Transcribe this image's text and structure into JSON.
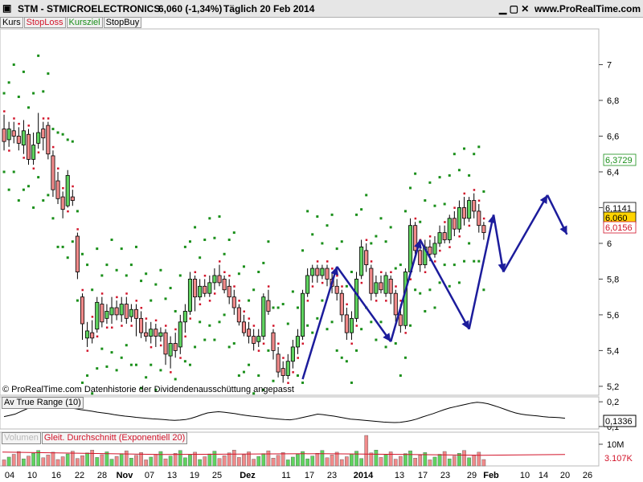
{
  "header": {
    "title": "STM - STMICROELECTRONICS",
    "price_change": "6,060 (-1,34%)",
    "period": "Täglich  20 Feb 2014",
    "site": "www.ProRealTime.com"
  },
  "window_icons": [
    "minimize-icon",
    "maximize-icon",
    "close-icon"
  ],
  "legend": [
    {
      "label": "Kurs",
      "color": "#000000"
    },
    {
      "label": "StopLoss",
      "color": "#d2142a"
    },
    {
      "label": "Kursziel",
      "color": "#1a8f1a"
    },
    {
      "label": "StopBuy",
      "color": "#000000"
    }
  ],
  "watermark": "© ProRealTime.com  Datenhistorie der Dividendenausschüttung angepasst",
  "price_axis": {
    "ticks": [
      "7",
      "6,8",
      "6,6",
      "6,4",
      "6,2",
      "6",
      "5,8",
      "5,6",
      "5,4",
      "5,2"
    ],
    "labels": [
      {
        "text": "6,3729",
        "value": 6.3729,
        "color": "#1a8f1a"
      },
      {
        "text": "6,1141",
        "value": 6.1141,
        "color": "#000000"
      },
      {
        "text": "6,060",
        "value": 6.06,
        "color": "#000000",
        "bg": "#ffd400"
      },
      {
        "text": "6,0156",
        "value": 6.0156,
        "color": "#d2142a"
      }
    ]
  },
  "atr_panel": {
    "label": "Av True Range (10)",
    "ticks": [
      "0,2",
      "0,1"
    ],
    "last_label": "0,1336"
  },
  "volume_panel": {
    "label_volume": "Volumen",
    "label_avg": "Gleit. Durchschnitt (Exponentiell 20)",
    "ticks": [
      "10M"
    ],
    "last_label": "3.107K"
  },
  "date_axis": [
    "04",
    "10",
    "16",
    "22",
    "28",
    "Nov",
    "07",
    "13",
    "19",
    "25",
    "Dez",
    "11",
    "17",
    "23",
    "2014",
    "13",
    "17",
    "23",
    "29",
    "Feb",
    "10",
    "14",
    "20",
    "26"
  ],
  "chart_data": {
    "type": "candlestick",
    "title": "STM - STMICROELECTRONICS",
    "ylim": [
      5.15,
      7.2
    ],
    "candles": [
      {
        "o": 6.64,
        "c": 6.57,
        "h": 6.72,
        "l": 6.52
      },
      {
        "o": 6.58,
        "c": 6.64,
        "h": 6.68,
        "l": 6.54
      },
      {
        "o": 6.63,
        "c": 6.6,
        "h": 6.68,
        "l": 6.56
      },
      {
        "o": 6.6,
        "c": 6.56,
        "h": 6.65,
        "l": 6.52
      },
      {
        "o": 6.55,
        "c": 6.63,
        "h": 6.69,
        "l": 6.5
      },
      {
        "o": 6.61,
        "c": 6.47,
        "h": 6.64,
        "l": 6.44
      },
      {
        "o": 6.47,
        "c": 6.55,
        "h": 6.62,
        "l": 6.44
      },
      {
        "o": 6.56,
        "c": 6.62,
        "h": 6.73,
        "l": 6.53
      },
      {
        "o": 6.64,
        "c": 6.59,
        "h": 6.68,
        "l": 6.52
      },
      {
        "o": 6.66,
        "c": 6.5,
        "h": 6.68,
        "l": 6.47
      },
      {
        "o": 6.49,
        "c": 6.3,
        "h": 6.52,
        "l": 6.26
      },
      {
        "o": 6.35,
        "c": 6.25,
        "h": 6.4,
        "l": 6.22
      },
      {
        "o": 6.26,
        "c": 6.19,
        "h": 6.29,
        "l": 6.14
      },
      {
        "o": 6.21,
        "c": 6.38,
        "h": 6.41,
        "l": 6.2
      },
      {
        "o": 6.26,
        "c": 6.24,
        "h": 6.3,
        "l": 6.21
      },
      {
        "o": 6.04,
        "c": 5.84,
        "h": 6.06,
        "l": 5.8
      },
      {
        "o": 5.7,
        "c": 5.55,
        "h": 5.72,
        "l": 5.46
      },
      {
        "o": 5.47,
        "c": 5.51,
        "h": 5.56,
        "l": 5.42
      },
      {
        "o": 5.5,
        "c": 5.47,
        "h": 5.57,
        "l": 5.44
      },
      {
        "o": 5.52,
        "c": 5.67,
        "h": 5.7,
        "l": 5.5
      },
      {
        "o": 5.66,
        "c": 5.56,
        "h": 5.7,
        "l": 5.53
      },
      {
        "o": 5.58,
        "c": 5.62,
        "h": 5.66,
        "l": 5.55
      },
      {
        "o": 5.6,
        "c": 5.64,
        "h": 5.7,
        "l": 5.55
      },
      {
        "o": 5.64,
        "c": 5.6,
        "h": 5.68,
        "l": 5.57
      },
      {
        "o": 5.6,
        "c": 5.66,
        "h": 5.7,
        "l": 5.56
      },
      {
        "o": 5.66,
        "c": 5.58,
        "h": 5.7,
        "l": 5.55
      },
      {
        "o": 5.59,
        "c": 5.63,
        "h": 5.66,
        "l": 5.56
      },
      {
        "o": 5.63,
        "c": 5.58,
        "h": 5.66,
        "l": 5.48
      },
      {
        "o": 5.58,
        "c": 5.5,
        "h": 5.62,
        "l": 5.47
      },
      {
        "o": 5.5,
        "c": 5.48,
        "h": 5.56,
        "l": 5.45
      },
      {
        "o": 5.48,
        "c": 5.52,
        "h": 5.56,
        "l": 5.44
      },
      {
        "o": 5.52,
        "c": 5.48,
        "h": 5.55,
        "l": 5.42
      },
      {
        "o": 5.48,
        "c": 5.5,
        "h": 5.53,
        "l": 5.45
      },
      {
        "o": 5.5,
        "c": 5.38,
        "h": 5.52,
        "l": 5.32
      },
      {
        "o": 5.37,
        "c": 5.44,
        "h": 5.48,
        "l": 5.3
      },
      {
        "o": 5.44,
        "c": 5.4,
        "h": 5.5,
        "l": 5.36
      },
      {
        "o": 5.42,
        "c": 5.56,
        "h": 5.6,
        "l": 5.38
      },
      {
        "o": 5.56,
        "c": 5.62,
        "h": 5.66,
        "l": 5.5
      },
      {
        "o": 5.62,
        "c": 5.8,
        "h": 5.84,
        "l": 5.6
      },
      {
        "o": 5.8,
        "c": 5.7,
        "h": 5.82,
        "l": 5.62
      },
      {
        "o": 5.7,
        "c": 5.76,
        "h": 5.8,
        "l": 5.68
      },
      {
        "o": 5.76,
        "c": 5.72,
        "h": 5.8,
        "l": 5.7
      },
      {
        "o": 5.72,
        "c": 5.78,
        "h": 5.82,
        "l": 5.7
      },
      {
        "o": 5.78,
        "c": 5.82,
        "h": 5.86,
        "l": 5.74
      },
      {
        "o": 5.82,
        "c": 5.78,
        "h": 5.88,
        "l": 5.76
      },
      {
        "o": 5.8,
        "c": 5.74,
        "h": 5.82,
        "l": 5.72
      },
      {
        "o": 5.76,
        "c": 5.7,
        "h": 5.8,
        "l": 5.66
      },
      {
        "o": 5.7,
        "c": 5.64,
        "h": 5.74,
        "l": 5.6
      },
      {
        "o": 5.64,
        "c": 5.56,
        "h": 5.66,
        "l": 5.54
      },
      {
        "o": 5.56,
        "c": 5.5,
        "h": 5.6,
        "l": 5.48
      },
      {
        "o": 5.52,
        "c": 5.48,
        "h": 5.56,
        "l": 5.44
      },
      {
        "o": 5.48,
        "c": 5.44,
        "h": 5.52,
        "l": 5.4
      },
      {
        "o": 5.45,
        "c": 5.48,
        "h": 5.52,
        "l": 5.42
      },
      {
        "o": 5.48,
        "c": 5.7,
        "h": 5.72,
        "l": 5.46
      },
      {
        "o": 5.68,
        "c": 5.62,
        "h": 5.74,
        "l": 5.6
      },
      {
        "o": 5.5,
        "c": 5.4,
        "h": 5.52,
        "l": 5.35
      },
      {
        "o": 5.38,
        "c": 5.28,
        "h": 5.42,
        "l": 5.25
      },
      {
        "o": 5.3,
        "c": 5.26,
        "h": 5.34,
        "l": 5.22
      },
      {
        "o": 5.26,
        "c": 5.34,
        "h": 5.38,
        "l": 5.24
      },
      {
        "o": 5.34,
        "c": 5.42,
        "h": 5.46,
        "l": 5.3
      },
      {
        "o": 5.42,
        "c": 5.48,
        "h": 5.52,
        "l": 5.38
      },
      {
        "o": 5.48,
        "c": 5.72,
        "h": 5.74,
        "l": 5.46
      },
      {
        "o": 5.72,
        "c": 5.82,
        "h": 5.86,
        "l": 5.7
      },
      {
        "o": 5.82,
        "c": 5.86,
        "h": 5.88,
        "l": 5.78
      },
      {
        "o": 5.86,
        "c": 5.82,
        "h": 5.88,
        "l": 5.78
      },
      {
        "o": 5.82,
        "c": 5.86,
        "h": 5.88,
        "l": 5.8
      },
      {
        "o": 5.86,
        "c": 5.8,
        "h": 5.88,
        "l": 5.76
      },
      {
        "o": 5.8,
        "c": 5.76,
        "h": 5.84,
        "l": 5.72
      },
      {
        "o": 5.76,
        "c": 5.72,
        "h": 5.8,
        "l": 5.68
      },
      {
        "o": 5.72,
        "c": 5.6,
        "h": 5.74,
        "l": 5.56
      },
      {
        "o": 5.6,
        "c": 5.5,
        "h": 5.64,
        "l": 5.46
      },
      {
        "o": 5.5,
        "c": 5.58,
        "h": 5.62,
        "l": 5.46
      },
      {
        "o": 5.58,
        "c": 5.8,
        "h": 5.84,
        "l": 5.56
      },
      {
        "o": 5.82,
        "c": 5.98,
        "h": 6.02,
        "l": 5.8
      },
      {
        "o": 5.96,
        "c": 5.88,
        "h": 6.0,
        "l": 5.84
      },
      {
        "o": 5.86,
        "c": 5.72,
        "h": 5.88,
        "l": 5.68
      },
      {
        "o": 5.72,
        "c": 5.78,
        "h": 5.82,
        "l": 5.7
      },
      {
        "o": 5.78,
        "c": 5.74,
        "h": 5.82,
        "l": 5.72
      },
      {
        "o": 5.72,
        "c": 5.82,
        "h": 5.84,
        "l": 5.7
      },
      {
        "o": 5.8,
        "c": 5.72,
        "h": 5.82,
        "l": 5.66
      },
      {
        "o": 5.72,
        "c": 5.6,
        "h": 5.74,
        "l": 5.56
      },
      {
        "o": 5.6,
        "c": 5.54,
        "h": 5.66,
        "l": 5.5
      },
      {
        "o": 5.54,
        "c": 5.84,
        "h": 5.86,
        "l": 5.52
      },
      {
        "o": 5.84,
        "c": 6.1,
        "h": 6.14,
        "l": 5.82
      },
      {
        "o": 6.1,
        "c": 5.96,
        "h": 6.12,
        "l": 5.94
      },
      {
        "o": 5.96,
        "c": 5.88,
        "h": 6.0,
        "l": 5.84
      },
      {
        "o": 5.88,
        "c": 5.98,
        "h": 6.02,
        "l": 5.86
      },
      {
        "o": 5.98,
        "c": 5.94,
        "h": 6.02,
        "l": 5.9
      },
      {
        "o": 5.94,
        "c": 6.0,
        "h": 6.04,
        "l": 5.92
      },
      {
        "o": 6.0,
        "c": 6.06,
        "h": 6.1,
        "l": 5.98
      },
      {
        "o": 6.06,
        "c": 6.02,
        "h": 6.1,
        "l": 6.0
      },
      {
        "o": 6.02,
        "c": 6.14,
        "h": 6.16,
        "l": 6.0
      },
      {
        "o": 6.14,
        "c": 6.08,
        "h": 6.18,
        "l": 6.04
      },
      {
        "o": 6.08,
        "c": 6.2,
        "h": 6.24,
        "l": 6.06
      },
      {
        "o": 6.2,
        "c": 6.14,
        "h": 6.26,
        "l": 6.1
      },
      {
        "o": 6.14,
        "c": 6.24,
        "h": 6.26,
        "l": 6.12
      },
      {
        "o": 6.24,
        "c": 6.18,
        "h": 6.28,
        "l": 6.14
      },
      {
        "o": 6.18,
        "c": 6.1,
        "h": 6.22,
        "l": 6.06
      },
      {
        "o": 6.1,
        "c": 6.06,
        "h": 6.12,
        "l": 6.02
      }
    ],
    "trend_line": [
      {
        "i": 61,
        "v": 5.24
      },
      {
        "i": 68,
        "v": 5.87
      },
      {
        "i": 79,
        "v": 5.45
      },
      {
        "i": 85,
        "v": 6.02
      },
      {
        "i": 95,
        "v": 5.52
      },
      {
        "i": 100,
        "v": 6.16
      },
      {
        "i": 102,
        "v": 5.84
      },
      {
        "i": 111,
        "v": 6.27
      },
      {
        "i": 115,
        "v": 6.05
      }
    ],
    "atr_series": [
      0.14,
      0.145,
      0.15,
      0.16,
      0.17,
      0.18,
      0.19,
      0.198,
      0.196,
      0.19,
      0.182,
      0.178,
      0.175,
      0.172,
      0.168,
      0.165,
      0.162,
      0.158,
      0.155,
      0.152,
      0.148,
      0.145,
      0.142,
      0.14,
      0.137,
      0.135,
      0.133,
      0.131,
      0.13,
      0.128,
      0.126,
      0.125,
      0.126,
      0.128,
      0.133,
      0.14,
      0.148,
      0.155,
      0.158,
      0.16,
      0.158,
      0.155,
      0.152,
      0.148,
      0.145,
      0.142,
      0.14,
      0.137,
      0.134,
      0.132,
      0.13,
      0.128,
      0.127,
      0.13,
      0.135,
      0.14,
      0.145,
      0.15,
      0.148,
      0.145,
      0.142,
      0.138,
      0.134,
      0.13,
      0.128,
      0.126,
      0.124,
      0.122,
      0.12,
      0.118,
      0.117,
      0.116,
      0.117,
      0.12,
      0.124,
      0.13,
      0.138,
      0.145,
      0.152,
      0.16,
      0.168,
      0.175,
      0.18,
      0.185,
      0.19,
      0.195,
      0.198,
      0.196,
      0.192,
      0.185,
      0.178,
      0.17,
      0.162,
      0.155,
      0.15,
      0.147,
      0.145,
      0.143,
      0.14,
      0.138,
      0.137,
      0.136,
      0.1336
    ],
    "volume_avg_level": 0.34,
    "volume_max": 12000000
  }
}
